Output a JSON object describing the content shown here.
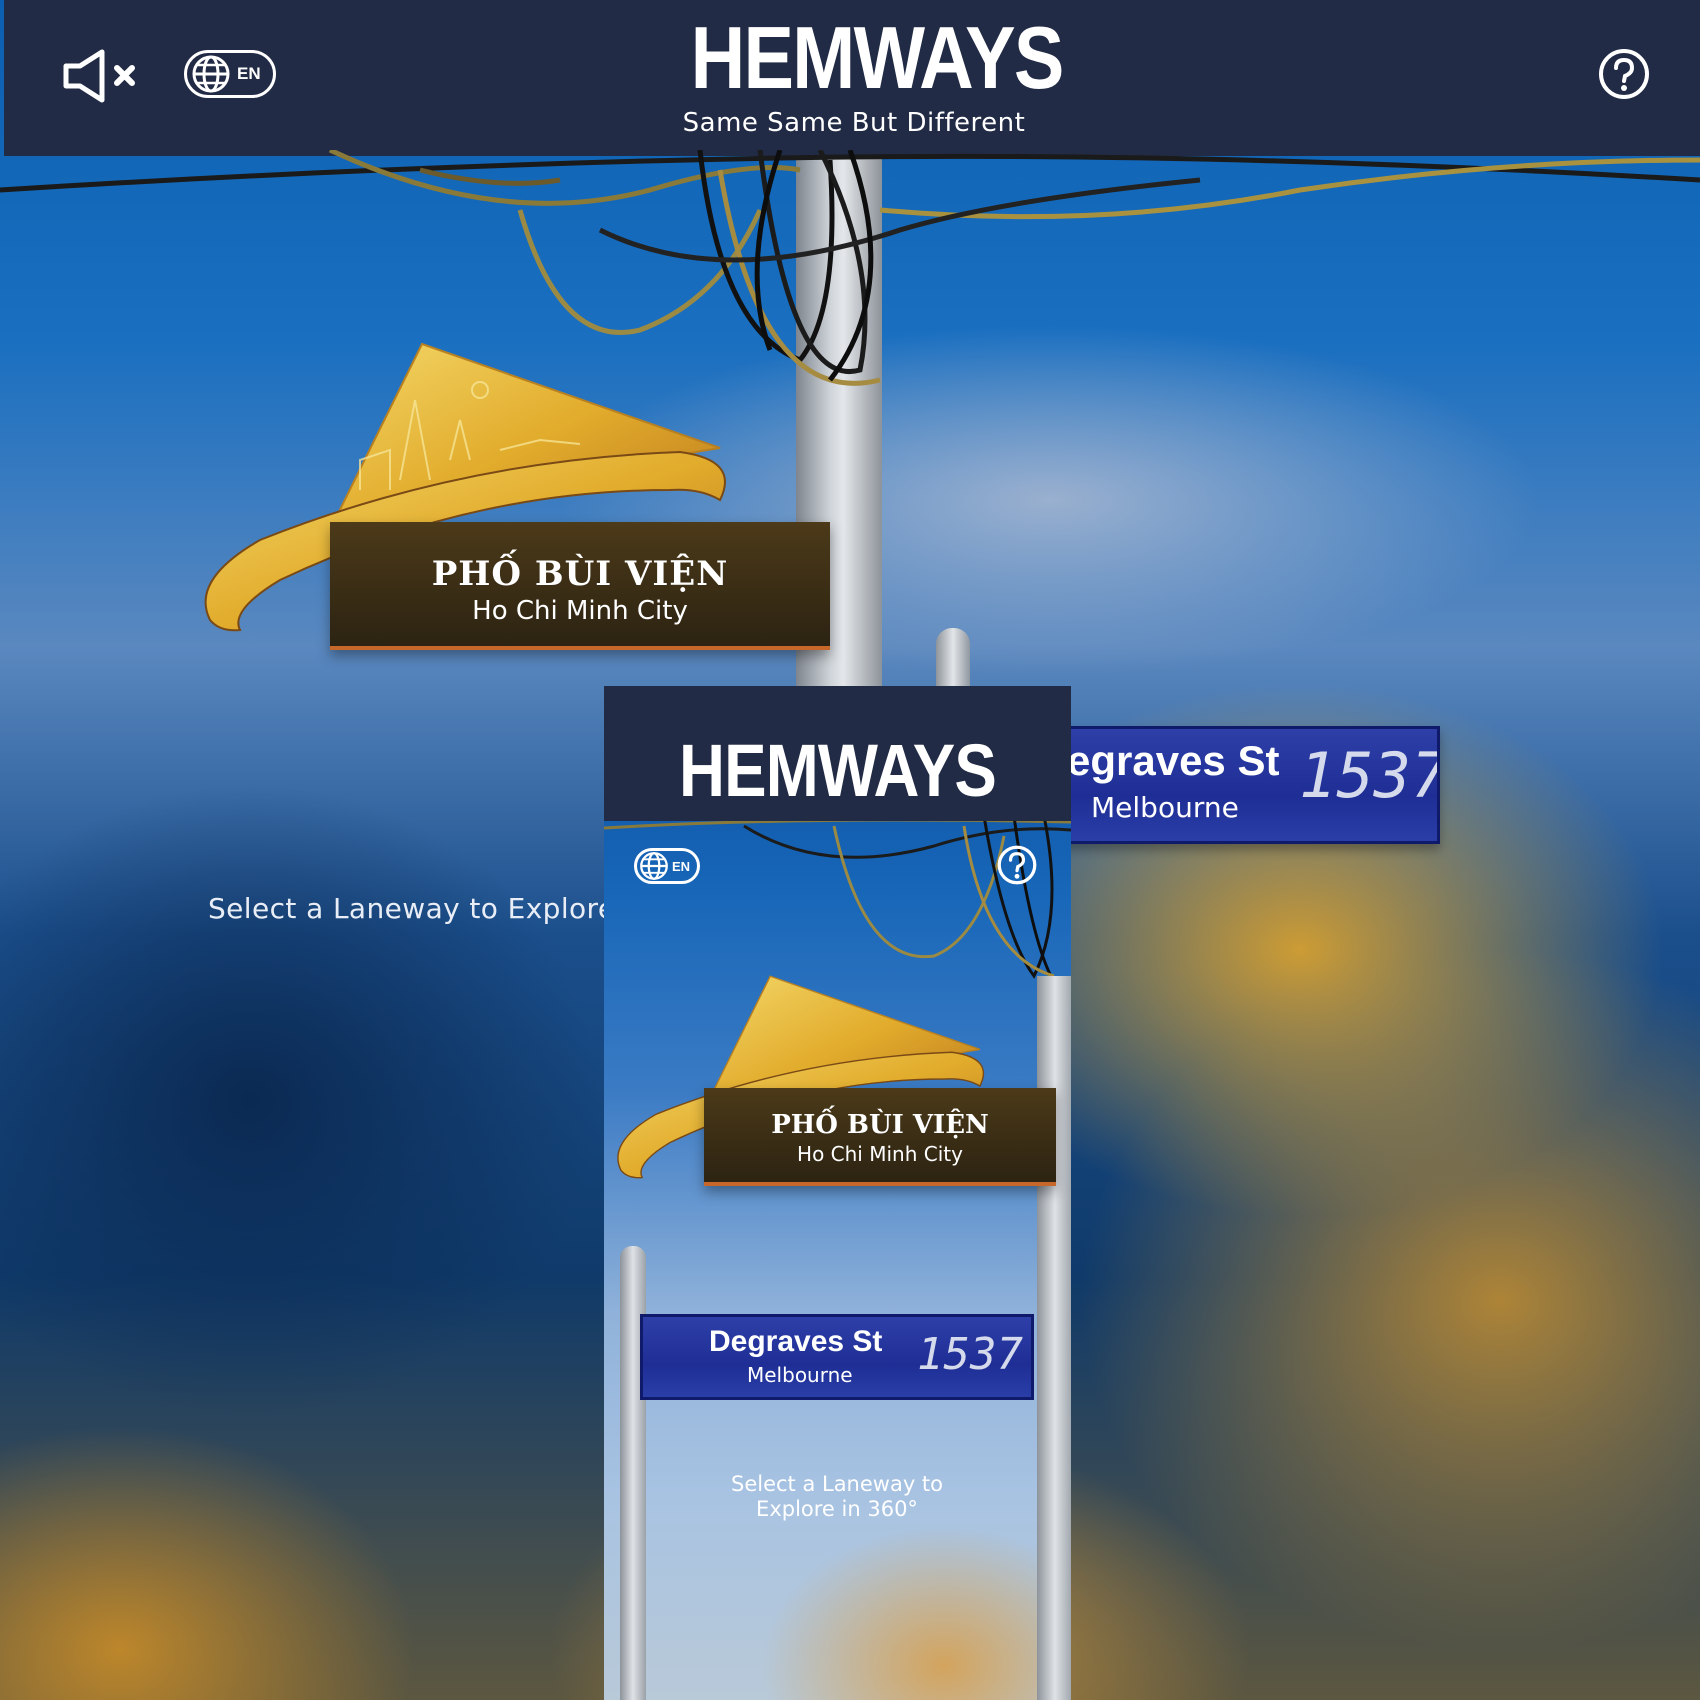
{
  "header": {
    "title": "HEMWAYS",
    "tagline": "Same Same But Different",
    "language_code": "EN"
  },
  "laneways": {
    "hcmc": {
      "name": "PHỐ BÙI VIỆN",
      "city": "Ho Chi Minh City"
    },
    "melbourne": {
      "name": "egraves St",
      "city": "Melbourne",
      "graffiti": "1537"
    }
  },
  "prompt": {
    "text": "Select a Laneway to Explore"
  },
  "mobile_preview": {
    "title": "HEMWAYS",
    "language_code": "EN",
    "hcmc": {
      "name": "PHỐ BÙI VIỆN",
      "city": "Ho Chi Minh City"
    },
    "melbourne": {
      "name": "Degraves St",
      "city": "Melbourne",
      "graffiti": "1537"
    },
    "prompt_line1": "Select a Laneway to",
    "prompt_line2": "Explore in 360°"
  },
  "icons": {
    "mute": "speaker-muted-icon",
    "language": "globe-icon",
    "help": "question-circle-icon"
  },
  "colors": {
    "header_bg": "#222b45",
    "hcmc_board": "#3a2d15",
    "melbourne_board": "#1e2e95",
    "gold": "#e3b63a"
  }
}
